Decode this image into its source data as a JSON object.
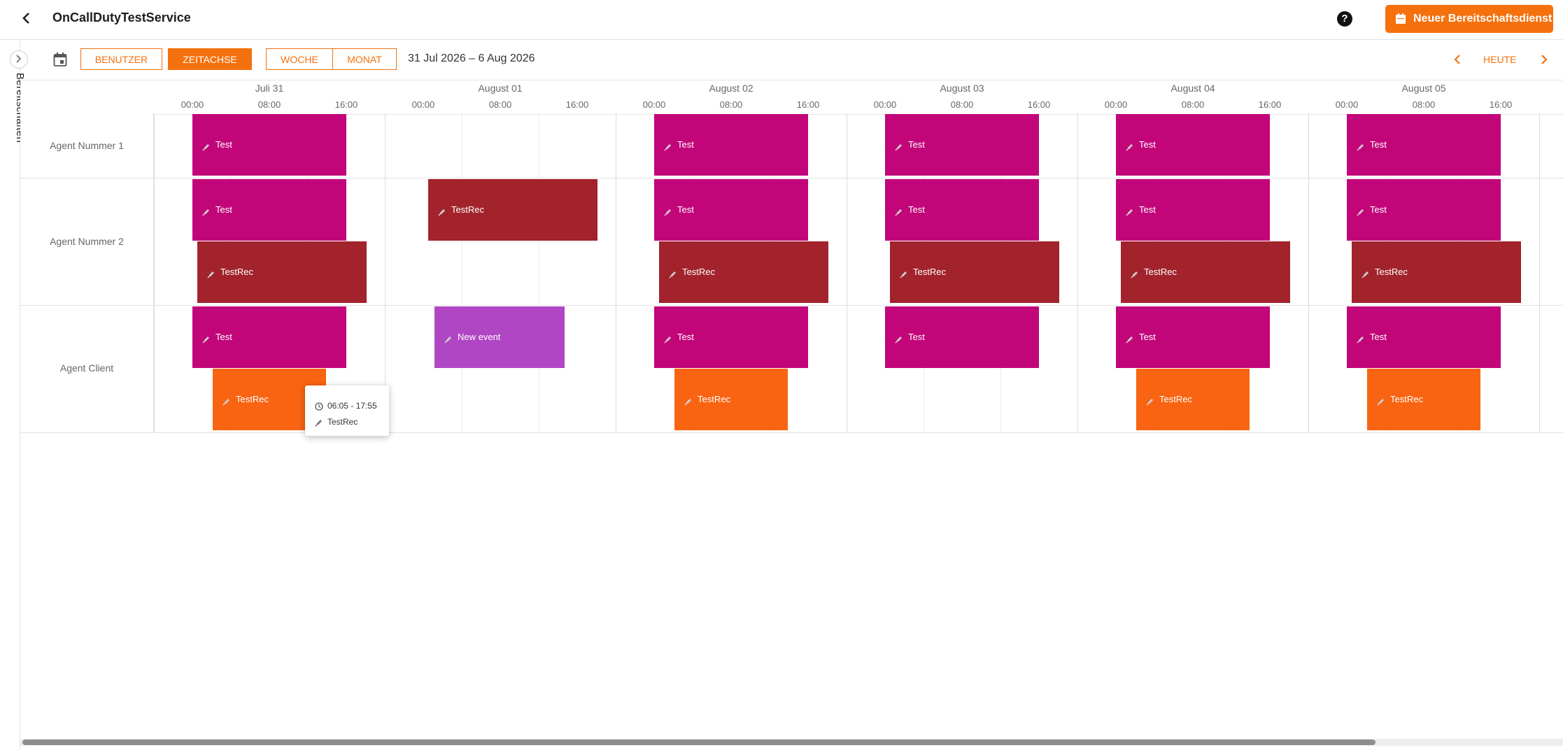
{
  "header": {
    "title": "OnCallDutyTestService",
    "help_icon_label": "?",
    "new_button_label": "Neuer Bereitschaftsdienst"
  },
  "sidebar": {
    "label": "Bereitschaften"
  },
  "toolbar": {
    "users_tab": "BENUTZER",
    "timeline_tab": "ZEITACHSE",
    "week_button": "WOCHE",
    "month_button": "MONAT",
    "active_tab": "ZEITACHSE",
    "date_range": "31 Jul 2026 – 6 Aug 2026",
    "today_button": "HEUTE"
  },
  "days": [
    {
      "label": "Juli 31",
      "hours": [
        "00:00",
        "08:00",
        "16:00"
      ]
    },
    {
      "label": "August 01",
      "hours": [
        "00:00",
        "08:00",
        "16:00"
      ]
    },
    {
      "label": "August 02",
      "hours": [
        "00:00",
        "08:00",
        "16:00"
      ]
    },
    {
      "label": "August 03",
      "hours": [
        "00:00",
        "08:00",
        "16:00"
      ]
    },
    {
      "label": "August 04",
      "hours": [
        "00:00",
        "08:00",
        "16:00"
      ]
    },
    {
      "label": "August 05",
      "hours": [
        "00:00",
        "08:00",
        "16:00"
      ]
    }
  ],
  "resources": [
    {
      "name": "Agent Nummer 1"
    },
    {
      "name": "Agent Nummer 2"
    },
    {
      "name": "Agent Client"
    }
  ],
  "events": [
    {
      "resource": 0,
      "lane": 0,
      "day": 0,
      "start": "00:00",
      "end": "16:00",
      "title": "Test",
      "kind": "test"
    },
    {
      "resource": 0,
      "lane": 0,
      "day": 2,
      "start": "00:00",
      "end": "16:00",
      "title": "Test",
      "kind": "test"
    },
    {
      "resource": 0,
      "lane": 0,
      "day": 3,
      "start": "00:00",
      "end": "16:00",
      "title": "Test",
      "kind": "test"
    },
    {
      "resource": 0,
      "lane": 0,
      "day": 4,
      "start": "00:00",
      "end": "16:00",
      "title": "Test",
      "kind": "test"
    },
    {
      "resource": 0,
      "lane": 0,
      "day": 5,
      "start": "00:00",
      "end": "16:00",
      "title": "Test",
      "kind": "test"
    },
    {
      "resource": 1,
      "lane": 0,
      "day": 0,
      "start": "00:00",
      "end": "16:00",
      "title": "Test",
      "kind": "test"
    },
    {
      "resource": 1,
      "lane": 0,
      "day": 1,
      "start": "00:30",
      "end": "18:05",
      "title": "TestRec",
      "kind": "rec"
    },
    {
      "resource": 1,
      "lane": 0,
      "day": 2,
      "start": "00:00",
      "end": "16:00",
      "title": "Test",
      "kind": "test"
    },
    {
      "resource": 1,
      "lane": 0,
      "day": 3,
      "start": "00:00",
      "end": "16:00",
      "title": "Test",
      "kind": "test"
    },
    {
      "resource": 1,
      "lane": 0,
      "day": 4,
      "start": "00:00",
      "end": "16:00",
      "title": "Test",
      "kind": "test"
    },
    {
      "resource": 1,
      "lane": 0,
      "day": 5,
      "start": "00:00",
      "end": "16:00",
      "title": "Test",
      "kind": "test"
    },
    {
      "resource": 1,
      "lane": 1,
      "day": 0,
      "start": "00:30",
      "end": "18:05",
      "title": "TestRec",
      "kind": "rec"
    },
    {
      "resource": 1,
      "lane": 1,
      "day": 2,
      "start": "00:30",
      "end": "18:05",
      "title": "TestRec",
      "kind": "rec"
    },
    {
      "resource": 1,
      "lane": 1,
      "day": 3,
      "start": "00:30",
      "end": "18:05",
      "title": "TestRec",
      "kind": "rec"
    },
    {
      "resource": 1,
      "lane": 1,
      "day": 4,
      "start": "00:30",
      "end": "18:05",
      "title": "TestRec",
      "kind": "rec"
    },
    {
      "resource": 1,
      "lane": 1,
      "day": 5,
      "start": "00:30",
      "end": "18:05",
      "title": "TestRec",
      "kind": "rec"
    },
    {
      "resource": 2,
      "lane": 0,
      "day": 0,
      "start": "00:00",
      "end": "16:00",
      "title": "Test",
      "kind": "test"
    },
    {
      "resource": 2,
      "lane": 0,
      "day": 1,
      "start": "01:10",
      "end": "14:40",
      "title": "New event",
      "kind": "new"
    },
    {
      "resource": 2,
      "lane": 0,
      "day": 2,
      "start": "00:00",
      "end": "16:00",
      "title": "Test",
      "kind": "test"
    },
    {
      "resource": 2,
      "lane": 0,
      "day": 3,
      "start": "00:00",
      "end": "16:00",
      "title": "Test",
      "kind": "test"
    },
    {
      "resource": 2,
      "lane": 0,
      "day": 4,
      "start": "00:00",
      "end": "16:00",
      "title": "Test",
      "kind": "test"
    },
    {
      "resource": 2,
      "lane": 0,
      "day": 5,
      "start": "00:00",
      "end": "16:00",
      "title": "Test",
      "kind": "test"
    },
    {
      "resource": 2,
      "lane": 1,
      "day": 0,
      "start": "02:05",
      "end": "13:50",
      "title": "TestRec",
      "kind": "orange"
    },
    {
      "resource": 2,
      "lane": 1,
      "day": 2,
      "start": "02:05",
      "end": "13:50",
      "title": "TestRec",
      "kind": "orange"
    },
    {
      "resource": 2,
      "lane": 1,
      "day": 4,
      "start": "02:05",
      "end": "13:50",
      "title": "TestRec",
      "kind": "orange"
    },
    {
      "resource": 2,
      "lane": 1,
      "day": 5,
      "start": "02:05",
      "end": "13:50",
      "title": "TestRec",
      "kind": "orange"
    }
  ],
  "tooltip": {
    "time": "06:05 - 17:55",
    "title": "TestRec"
  },
  "colors": {
    "accent": "#f5710e",
    "test": "#c2067a",
    "rec": "#a2232c",
    "new": "#b146c5",
    "orange": "#f86412"
  }
}
